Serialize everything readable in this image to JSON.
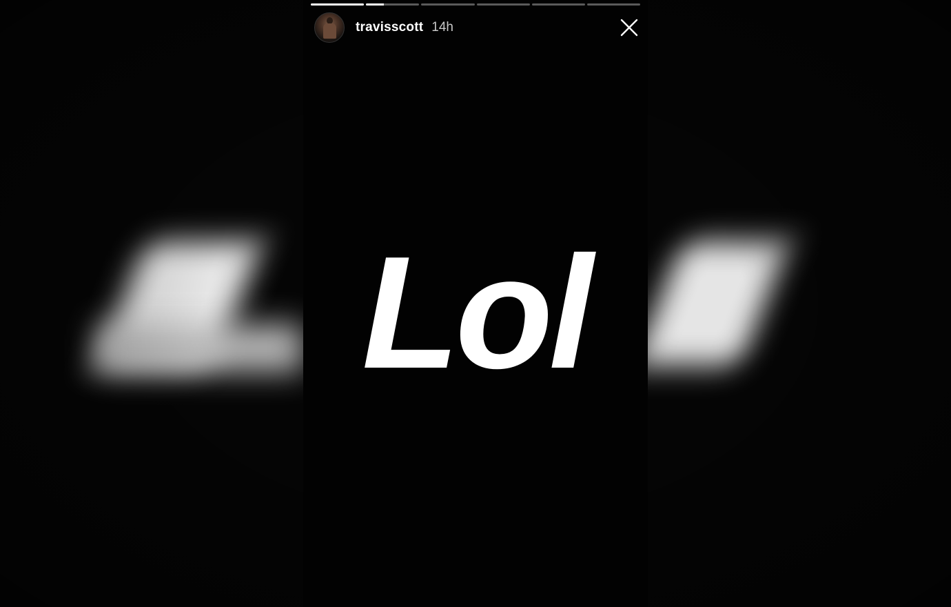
{
  "story": {
    "username": "travisscott",
    "timestamp": "14h",
    "text": "Lol",
    "progress_segments": [
      1.0,
      0.33,
      0,
      0,
      0,
      0
    ]
  },
  "icons": {
    "avatar": "profile-avatar",
    "close": "close-icon"
  },
  "colors": {
    "background": "#000000",
    "text": "#ffffff",
    "timestamp": "#c8c8c8",
    "progress_track": "rgba(255,255,255,0.35)",
    "progress_fill": "#ffffff"
  }
}
